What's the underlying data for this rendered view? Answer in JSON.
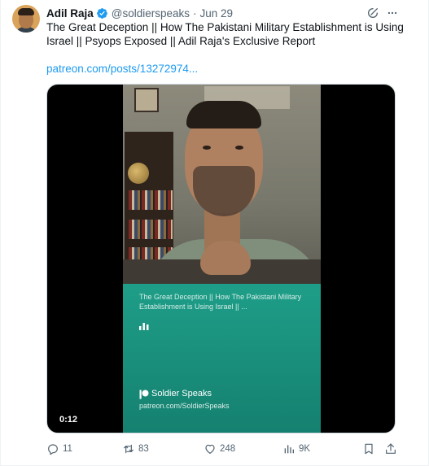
{
  "author": {
    "name": "Adil Raja",
    "handle": "@soldierspeaks",
    "separator": "·",
    "date": "Jun 29"
  },
  "tweet": {
    "text": "The Great Deception || How The Pakistani Military Establishment is Using Israel || Psyops Exposed || Adil Raja's Exclusive Report",
    "link": "patreon.com/posts/13272974..."
  },
  "media": {
    "overlay_title": "The Great Deception || How The Pakistani Military Establishment is Using Israel || ...",
    "brand_name": "Soldier Speaks",
    "brand_url": "patreon.com/SoldierSpeaks",
    "timecode": "0:12"
  },
  "actions": {
    "replies": "11",
    "reposts": "83",
    "likes": "248",
    "views": "9K"
  },
  "icons": {
    "verified": "verified-badge-icon",
    "grok": "grok-icon",
    "more": "more-icon",
    "reply": "reply-icon",
    "repost": "repost-icon",
    "like": "like-icon",
    "views": "views-icon",
    "bookmark": "bookmark-icon",
    "share": "share-icon"
  },
  "colors": {
    "text": "#0f1419",
    "muted": "#536471",
    "link": "#1d9bf0",
    "verified": "#1d9bf0",
    "overlay": "#1e9e88"
  }
}
